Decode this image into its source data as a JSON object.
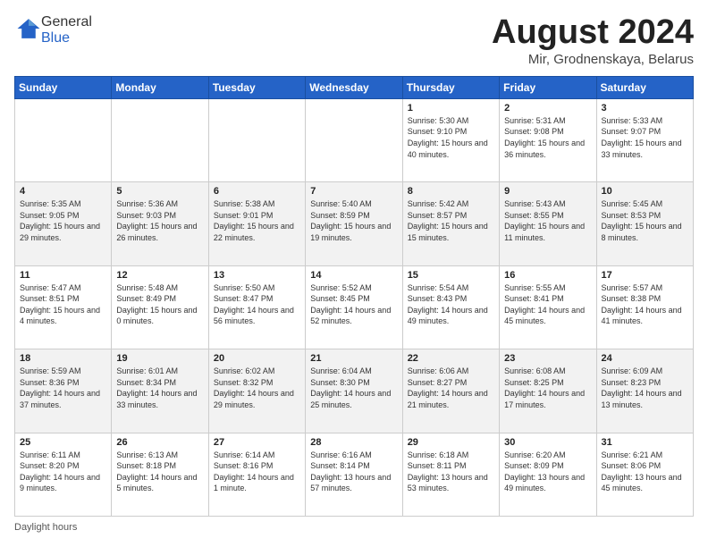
{
  "logo": {
    "general": "General",
    "blue": "Blue"
  },
  "title": "August 2024",
  "location": "Mir, Grodnenskaya, Belarus",
  "weekdays": [
    "Sunday",
    "Monday",
    "Tuesday",
    "Wednesday",
    "Thursday",
    "Friday",
    "Saturday"
  ],
  "footer": {
    "label": "Daylight hours"
  },
  "weeks": [
    [
      {
        "day": "",
        "info": ""
      },
      {
        "day": "",
        "info": ""
      },
      {
        "day": "",
        "info": ""
      },
      {
        "day": "",
        "info": ""
      },
      {
        "day": "1",
        "info": "Sunrise: 5:30 AM\nSunset: 9:10 PM\nDaylight: 15 hours\nand 40 minutes."
      },
      {
        "day": "2",
        "info": "Sunrise: 5:31 AM\nSunset: 9:08 PM\nDaylight: 15 hours\nand 36 minutes."
      },
      {
        "day": "3",
        "info": "Sunrise: 5:33 AM\nSunset: 9:07 PM\nDaylight: 15 hours\nand 33 minutes."
      }
    ],
    [
      {
        "day": "4",
        "info": "Sunrise: 5:35 AM\nSunset: 9:05 PM\nDaylight: 15 hours\nand 29 minutes."
      },
      {
        "day": "5",
        "info": "Sunrise: 5:36 AM\nSunset: 9:03 PM\nDaylight: 15 hours\nand 26 minutes."
      },
      {
        "day": "6",
        "info": "Sunrise: 5:38 AM\nSunset: 9:01 PM\nDaylight: 15 hours\nand 22 minutes."
      },
      {
        "day": "7",
        "info": "Sunrise: 5:40 AM\nSunset: 8:59 PM\nDaylight: 15 hours\nand 19 minutes."
      },
      {
        "day": "8",
        "info": "Sunrise: 5:42 AM\nSunset: 8:57 PM\nDaylight: 15 hours\nand 15 minutes."
      },
      {
        "day": "9",
        "info": "Sunrise: 5:43 AM\nSunset: 8:55 PM\nDaylight: 15 hours\nand 11 minutes."
      },
      {
        "day": "10",
        "info": "Sunrise: 5:45 AM\nSunset: 8:53 PM\nDaylight: 15 hours\nand 8 minutes."
      }
    ],
    [
      {
        "day": "11",
        "info": "Sunrise: 5:47 AM\nSunset: 8:51 PM\nDaylight: 15 hours\nand 4 minutes."
      },
      {
        "day": "12",
        "info": "Sunrise: 5:48 AM\nSunset: 8:49 PM\nDaylight: 15 hours\nand 0 minutes."
      },
      {
        "day": "13",
        "info": "Sunrise: 5:50 AM\nSunset: 8:47 PM\nDaylight: 14 hours\nand 56 minutes."
      },
      {
        "day": "14",
        "info": "Sunrise: 5:52 AM\nSunset: 8:45 PM\nDaylight: 14 hours\nand 52 minutes."
      },
      {
        "day": "15",
        "info": "Sunrise: 5:54 AM\nSunset: 8:43 PM\nDaylight: 14 hours\nand 49 minutes."
      },
      {
        "day": "16",
        "info": "Sunrise: 5:55 AM\nSunset: 8:41 PM\nDaylight: 14 hours\nand 45 minutes."
      },
      {
        "day": "17",
        "info": "Sunrise: 5:57 AM\nSunset: 8:38 PM\nDaylight: 14 hours\nand 41 minutes."
      }
    ],
    [
      {
        "day": "18",
        "info": "Sunrise: 5:59 AM\nSunset: 8:36 PM\nDaylight: 14 hours\nand 37 minutes."
      },
      {
        "day": "19",
        "info": "Sunrise: 6:01 AM\nSunset: 8:34 PM\nDaylight: 14 hours\nand 33 minutes."
      },
      {
        "day": "20",
        "info": "Sunrise: 6:02 AM\nSunset: 8:32 PM\nDaylight: 14 hours\nand 29 minutes."
      },
      {
        "day": "21",
        "info": "Sunrise: 6:04 AM\nSunset: 8:30 PM\nDaylight: 14 hours\nand 25 minutes."
      },
      {
        "day": "22",
        "info": "Sunrise: 6:06 AM\nSunset: 8:27 PM\nDaylight: 14 hours\nand 21 minutes."
      },
      {
        "day": "23",
        "info": "Sunrise: 6:08 AM\nSunset: 8:25 PM\nDaylight: 14 hours\nand 17 minutes."
      },
      {
        "day": "24",
        "info": "Sunrise: 6:09 AM\nSunset: 8:23 PM\nDaylight: 14 hours\nand 13 minutes."
      }
    ],
    [
      {
        "day": "25",
        "info": "Sunrise: 6:11 AM\nSunset: 8:20 PM\nDaylight: 14 hours\nand 9 minutes."
      },
      {
        "day": "26",
        "info": "Sunrise: 6:13 AM\nSunset: 8:18 PM\nDaylight: 14 hours\nand 5 minutes."
      },
      {
        "day": "27",
        "info": "Sunrise: 6:14 AM\nSunset: 8:16 PM\nDaylight: 14 hours\nand 1 minute."
      },
      {
        "day": "28",
        "info": "Sunrise: 6:16 AM\nSunset: 8:14 PM\nDaylight: 13 hours\nand 57 minutes."
      },
      {
        "day": "29",
        "info": "Sunrise: 6:18 AM\nSunset: 8:11 PM\nDaylight: 13 hours\nand 53 minutes."
      },
      {
        "day": "30",
        "info": "Sunrise: 6:20 AM\nSunset: 8:09 PM\nDaylight: 13 hours\nand 49 minutes."
      },
      {
        "day": "31",
        "info": "Sunrise: 6:21 AM\nSunset: 8:06 PM\nDaylight: 13 hours\nand 45 minutes."
      }
    ]
  ]
}
